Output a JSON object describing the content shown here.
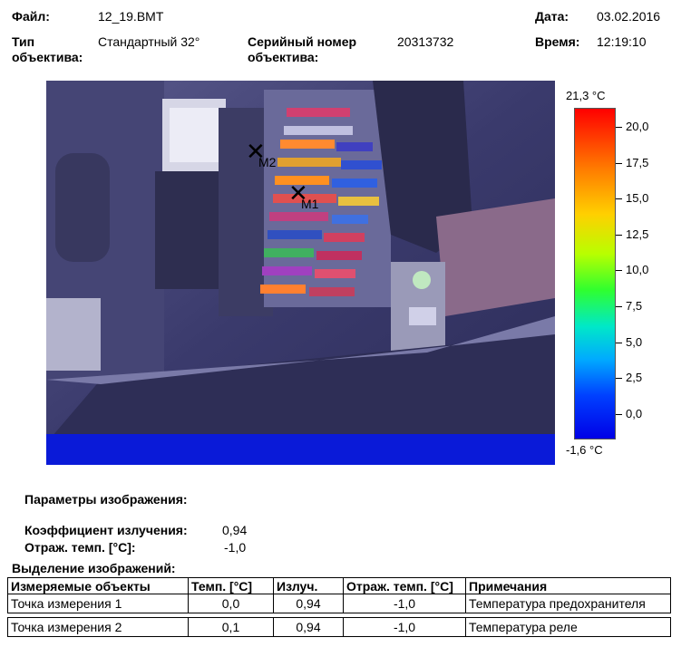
{
  "header": {
    "file_label": "Файл:",
    "file_value": "12_19.BMT",
    "date_label": "Дата:",
    "date_value": "03.02.2016",
    "lens_type_label_1": "Тип",
    "lens_type_label_2": "объектива:",
    "lens_type_value": "Стандартный 32°",
    "serial_label_1": "Серийный номер",
    "serial_label_2": "объектива:",
    "serial_value": "20313732",
    "time_label": "Время:",
    "time_value": "12:19:10"
  },
  "thermal_image": {
    "markers": [
      {
        "label": "M1"
      },
      {
        "label": "M2"
      }
    ]
  },
  "color_scale": {
    "max_label": "21,3 °C",
    "min_label": "-1,6 °C",
    "ticks": [
      "20,0",
      "17,5",
      "15,0",
      "12,5",
      "10,0",
      "7,5",
      "5,0",
      "2,5",
      "0,0"
    ],
    "colors": [
      "#ff0000",
      "#ff7a00",
      "#ffd000",
      "#2fff2f",
      "#00e8c8",
      "#00aaff",
      "#0000e6"
    ]
  },
  "image_params": {
    "title": "Параметры изображения:",
    "emissivity_label": "Коэффициент излучения:",
    "emissivity_value": "0,94",
    "refl_temp_label": "Отраж. темп. [°C]:",
    "refl_temp_value": "-1,0"
  },
  "markings": {
    "title": "Выделение изображений:",
    "columns": [
      "Измеряемые объекты",
      "Темп. [°C]",
      "Излуч.",
      "Отраж. темп. [°C]",
      "Примечания"
    ],
    "rows": [
      {
        "object": "Точка измерения 1",
        "temp": "0,0",
        "emis": "0,94",
        "refl": "-1,0",
        "note": "Температура предохранителя"
      },
      {
        "object": "Точка измерения 2",
        "temp": "0,1",
        "emis": "0,94",
        "refl": "-1,0",
        "note": "Температура реле"
      }
    ]
  }
}
